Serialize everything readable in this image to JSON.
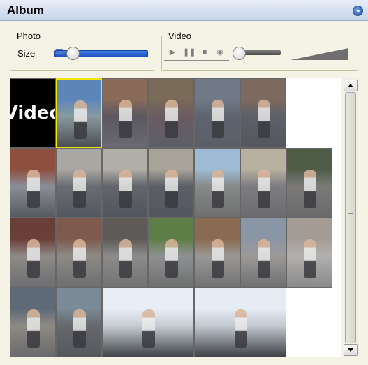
{
  "header": {
    "title": "Album"
  },
  "photo": {
    "legend": "Photo",
    "size_label": "Size",
    "size_level": 0.12
  },
  "video": {
    "legend": "Video",
    "controls": [
      "play-icon",
      "pause-icon",
      "stop-icon",
      "camera-icon"
    ],
    "position_level": 0.0,
    "volume_level": 1.0
  },
  "grid": {
    "video_tile_label": "Video",
    "tiles": [
      {
        "col": 0,
        "row": 0,
        "span": 1,
        "type": "video",
        "colors": [
          "#000000",
          "#000000",
          "#000000"
        ]
      },
      {
        "col": 1,
        "row": 0,
        "span": 1,
        "type": "photo",
        "selected": true,
        "colors": [
          "#5d86b8",
          "#8a9aa0",
          "#4b4f55"
        ]
      },
      {
        "col": 2,
        "row": 0,
        "span": 1,
        "type": "photo",
        "colors": [
          "#8a6b5a",
          "#5c5760",
          "#6a6a70"
        ]
      },
      {
        "col": 3,
        "row": 0,
        "span": 1,
        "type": "photo",
        "colors": [
          "#7a6a58",
          "#6b5b63",
          "#5b5e66"
        ]
      },
      {
        "col": 4,
        "row": 0,
        "span": 1,
        "type": "photo",
        "colors": [
          "#6f7a86",
          "#5e6470",
          "#5a5e66"
        ]
      },
      {
        "col": 5,
        "row": 0,
        "span": 1,
        "type": "photo",
        "colors": [
          "#7c6a60",
          "#5d5f69",
          "#55585f"
        ]
      },
      {
        "col": 0,
        "row": 1,
        "span": 1,
        "type": "photo",
        "colors": [
          "#8e4f3f",
          "#8b8e96",
          "#555960"
        ]
      },
      {
        "col": 1,
        "row": 1,
        "span": 1,
        "type": "photo",
        "colors": [
          "#a9a7a2",
          "#6a6c72",
          "#545860"
        ]
      },
      {
        "col": 2,
        "row": 1,
        "span": 1,
        "type": "photo",
        "colors": [
          "#b0aea6",
          "#64666c",
          "#50545c"
        ]
      },
      {
        "col": 3,
        "row": 1,
        "span": 1,
        "type": "photo",
        "colors": [
          "#a8a49a",
          "#5b5e66",
          "#535760"
        ]
      },
      {
        "col": 4,
        "row": 1,
        "span": 1,
        "type": "photo",
        "colors": [
          "#9ebad4",
          "#868a88",
          "#6f6f70"
        ]
      },
      {
        "col": 5,
        "row": 1,
        "span": 1,
        "type": "photo",
        "colors": [
          "#b8b0a0",
          "#7d7c80",
          "#6c6c70"
        ]
      },
      {
        "col": 6,
        "row": 1,
        "span": 1,
        "type": "photo",
        "colors": [
          "#4e5c48",
          "#7c7a78",
          "#6a6a6c"
        ]
      },
      {
        "col": 0,
        "row": 2,
        "span": 1,
        "type": "photo",
        "colors": [
          "#6a3f38",
          "#8e8a88",
          "#6c6e70"
        ]
      },
      {
        "col": 1,
        "row": 2,
        "span": 1,
        "type": "photo",
        "colors": [
          "#7d5a4c",
          "#8d8a86",
          "#6e6e70"
        ]
      },
      {
        "col": 2,
        "row": 2,
        "span": 1,
        "type": "photo",
        "colors": [
          "#5d5a58",
          "#8e8c8a",
          "#727274"
        ]
      },
      {
        "col": 3,
        "row": 2,
        "span": 1,
        "type": "photo",
        "colors": [
          "#5e7e48",
          "#8e9092",
          "#6e7070"
        ]
      },
      {
        "col": 4,
        "row": 2,
        "span": 1,
        "type": "photo",
        "colors": [
          "#8a6a50",
          "#9a9896",
          "#727272"
        ]
      },
      {
        "col": 5,
        "row": 2,
        "span": 1,
        "type": "photo",
        "colors": [
          "#8a96a4",
          "#9c9a98",
          "#707070"
        ]
      },
      {
        "col": 6,
        "row": 2,
        "span": 1,
        "type": "photo",
        "colors": [
          "#a49c94",
          "#b2b0ae",
          "#8a8a8a"
        ]
      },
      {
        "col": 0,
        "row": 3,
        "span": 1,
        "type": "photo",
        "colors": [
          "#5e6a78",
          "#8e8a84",
          "#6a6a6c"
        ]
      },
      {
        "col": 1,
        "row": 3,
        "span": 1,
        "type": "photo",
        "colors": [
          "#7a8a96",
          "#66686c",
          "#55585c"
        ]
      },
      {
        "col": 2,
        "row": 3,
        "span": 2,
        "type": "photo",
        "colors": [
          "#e8eef6",
          "#c6ccd2",
          "#404448"
        ]
      },
      {
        "col": 4,
        "row": 3,
        "span": 2,
        "type": "photo",
        "colors": [
          "#e6ecf4",
          "#c2c8cf",
          "#3e4246"
        ]
      }
    ]
  }
}
